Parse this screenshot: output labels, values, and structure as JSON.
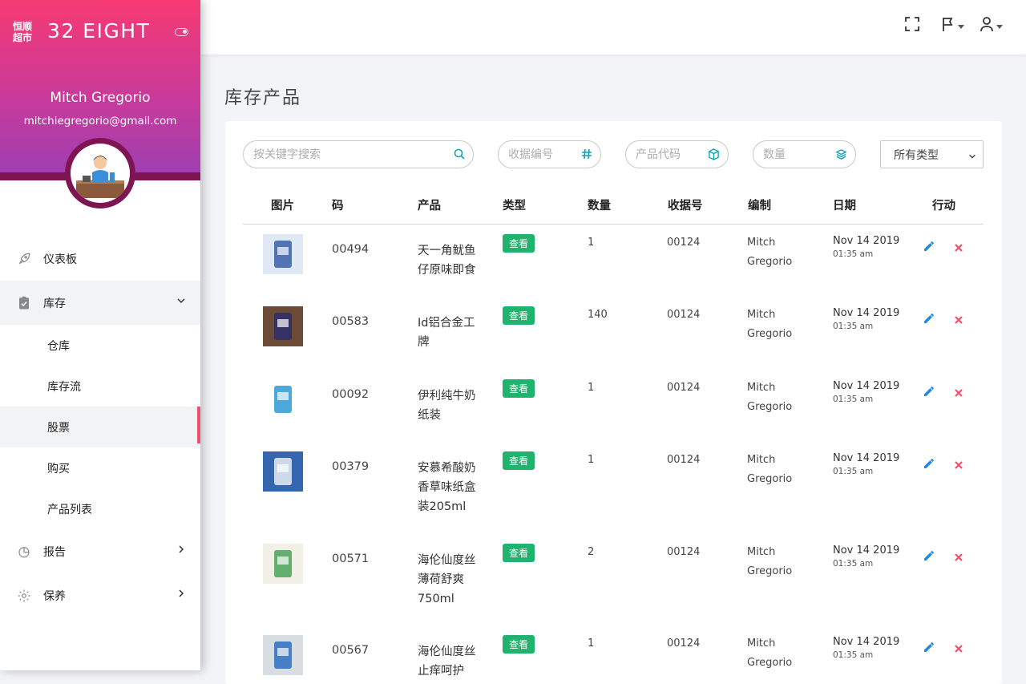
{
  "sidebar": {
    "logo_text": "恒顺超市",
    "brand": "32 EIGHT",
    "user_name": "Mitch Gregorio",
    "user_email": "mitchiegregorio@gmail.com",
    "menu": [
      {
        "label": "仪表板",
        "icon": "rocket-icon"
      },
      {
        "label": "库存",
        "icon": "clipboard-check-icon"
      },
      {
        "label": "报告",
        "icon": "pie-chart-icon"
      },
      {
        "label": "保养",
        "icon": "gear-icon"
      }
    ],
    "submenu": [
      "仓库",
      "库存流",
      "股票",
      "购买",
      "产品列表"
    ]
  },
  "page": {
    "title": "库存产品"
  },
  "filters": {
    "search_placeholder": "按关键字搜索",
    "receipt_placeholder": "收据编号",
    "product_code_placeholder": "产品代码",
    "quantity_placeholder": "数量",
    "type_selected": "所有类型"
  },
  "table": {
    "columns": [
      "图片",
      "码",
      "产品",
      "类型",
      "数量",
      "收据号",
      "编制",
      "日期",
      "行动"
    ],
    "rows": [
      {
        "code": "00494",
        "product": "天一角鱿鱼仔原味即食",
        "type": "查看",
        "qty": "1",
        "receipt": "00124",
        "maker": "Mitch Gregorio",
        "date": "Nov 14 2019",
        "time": "01:35 am"
      },
      {
        "code": "00583",
        "product": "Id铝合金工牌",
        "type": "查看",
        "qty": "140",
        "receipt": "00124",
        "maker": "Mitch Gregorio",
        "date": "Nov 14 2019",
        "time": "01:35 am"
      },
      {
        "code": "00092",
        "product": "伊利纯牛奶纸装",
        "type": "查看",
        "qty": "1",
        "receipt": "00124",
        "maker": "Mitch Gregorio",
        "date": "Nov 14 2019",
        "time": "01:35 am"
      },
      {
        "code": "00379",
        "product": "安慕希酸奶香草味纸盒装205ml",
        "type": "查看",
        "qty": "1",
        "receipt": "00124",
        "maker": "Mitch Gregorio",
        "date": "Nov 14 2019",
        "time": "01:35 am"
      },
      {
        "code": "00571",
        "product": "海伦仙度丝薄荷舒爽750ml",
        "type": "查看",
        "qty": "2",
        "receipt": "00124",
        "maker": "Mitch Gregorio",
        "date": "Nov 14 2019",
        "time": "01:35 am"
      },
      {
        "code": "00567",
        "product": "海伦仙度丝止痒呵护",
        "type": "查看",
        "qty": "1",
        "receipt": "00124",
        "maker": "Mitch Gregorio",
        "date": "Nov 14 2019",
        "time": "01:35 am"
      }
    ]
  },
  "colors": {
    "accent": "#f73a73",
    "badge": "#20b36e",
    "edit": "#1e88e5",
    "delete": "#f0506e",
    "teal": "#17a2b8"
  }
}
